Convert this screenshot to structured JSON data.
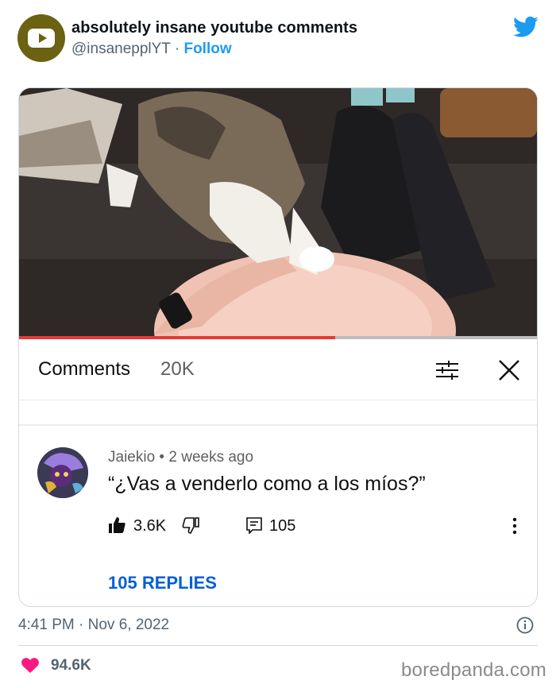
{
  "tweet": {
    "account_name": "absolutely insane youtube comments",
    "handle": "@insanepplYT",
    "separator": " · ",
    "follow_label": "Follow",
    "timestamp": "4:41 PM · Nov 6, 2022",
    "likes": "94.6K"
  },
  "youtube": {
    "video_progress": 0.61,
    "comments_label": "Comments",
    "comments_count": "20K",
    "comment": {
      "author": "Jaiekio",
      "dot": " • ",
      "age": "2 weeks ago",
      "text": "“¿Vas a venderlo como a los míos?”",
      "likes": "3.6K",
      "replies_count": "105",
      "replies_link": "105 REPLIES"
    }
  },
  "watermark": "boredpanda.com",
  "colors": {
    "twitter_blue": "#1d9bf0",
    "youtube_red": "#e53935",
    "youtube_link_blue": "#065fd4",
    "heart_pink": "#f91880",
    "avatar_olive": "#6b6212"
  },
  "icons": [
    "youtube-logo-icon",
    "twitter-bird-icon",
    "sort-icon",
    "close-icon",
    "thumbs-up-icon",
    "thumbs-down-icon",
    "reply-icon",
    "more-vertical-icon",
    "info-icon",
    "heart-icon"
  ]
}
